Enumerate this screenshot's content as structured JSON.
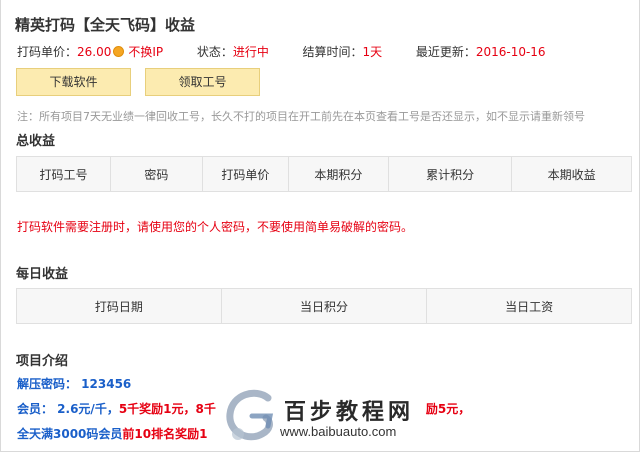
{
  "title": "精英打码【全天飞码】收益",
  "info": {
    "price_label": "打码单价：",
    "price_value": "26.00",
    "ip_note": "不换IP",
    "status_label": "状态：",
    "status_value": "进行中",
    "settle_label": "结算时间：",
    "settle_value": "1天",
    "update_label": "最近更新：",
    "update_value": "2016-10-16"
  },
  "buttons": {
    "download": "下载软件",
    "get_id": "领取工号"
  },
  "note": "注：所有项目7天无业绩一律回收工号，长久不打的项目在开工前先在本页查看工号是否还显示，如不显示请重新领号",
  "total": {
    "title": "总收益",
    "columns": [
      "打码工号",
      "密码",
      "打码单价",
      "本期积分",
      "累计积分",
      "本期收益"
    ]
  },
  "warning": "打码软件需要注册时，请使用您的个人密码，不要使用简单易破解的密码。",
  "daily": {
    "title": "每日收益",
    "columns": [
      "打码日期",
      "当日积分",
      "当日工资"
    ]
  },
  "intro": {
    "title": "项目介绍",
    "line1": "解压密码：  123456",
    "line2_a": "会员：  2.6元/千，",
    "line2_b": "5千奖励1元，",
    "line2_c": "8千",
    "line2_d": "励5元，",
    "line3_a": "全天满3000码会员",
    "line3_b": "前10排名奖励1"
  },
  "watermark": {
    "cn": "百步教程网",
    "url": "www.baibuauto.com"
  }
}
